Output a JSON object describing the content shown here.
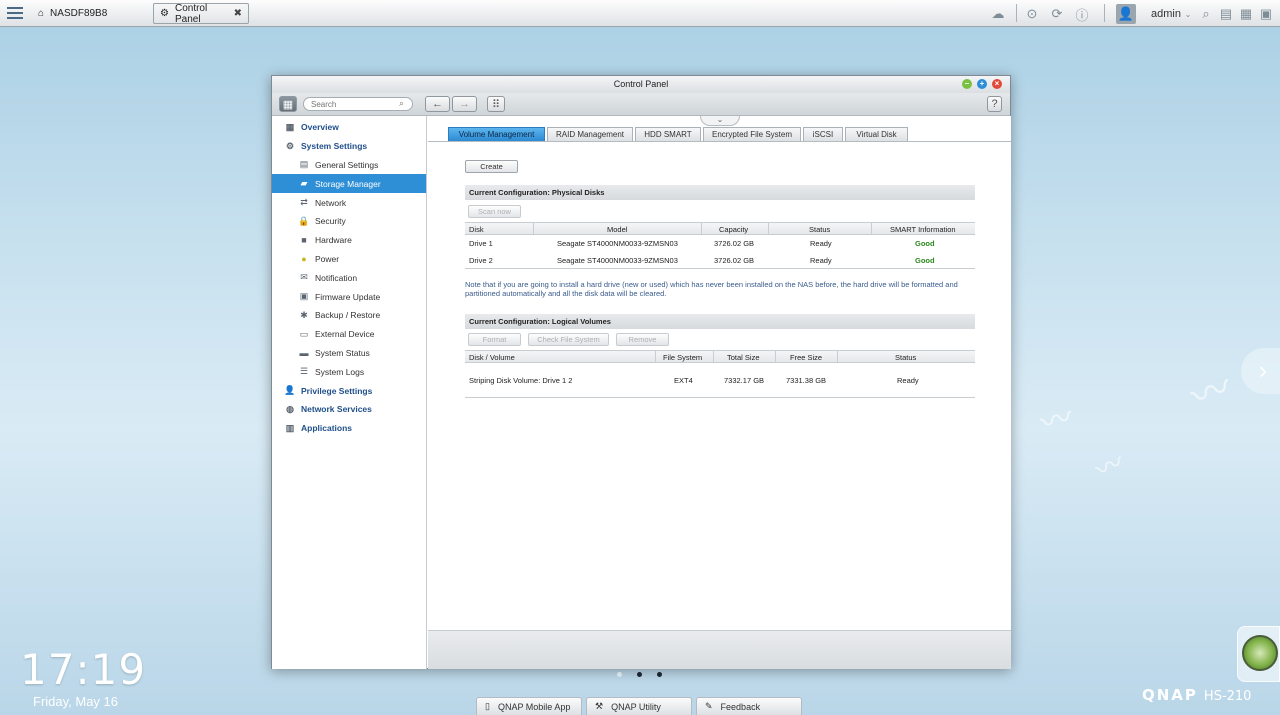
{
  "taskbar": {
    "home_tab": "NASDF89B8",
    "app_tab": "Control Panel",
    "user": "admin"
  },
  "window": {
    "title": "Control Panel",
    "search_placeholder": "Search"
  },
  "sidebar": {
    "items": [
      {
        "label": "Overview",
        "level": "top",
        "icon": "overview-icon"
      },
      {
        "label": "System Settings",
        "level": "top",
        "icon": "gear-icon"
      },
      {
        "label": "General Settings",
        "level": "sub",
        "icon": "general-settings-icon"
      },
      {
        "label": "Storage Manager",
        "level": "sub",
        "icon": "storage-icon",
        "active": true
      },
      {
        "label": "Network",
        "level": "sub",
        "icon": "network-icon"
      },
      {
        "label": "Security",
        "level": "sub",
        "icon": "lock-icon"
      },
      {
        "label": "Hardware",
        "level": "sub",
        "icon": "hardware-icon"
      },
      {
        "label": "Power",
        "level": "sub",
        "icon": "lightbulb-icon"
      },
      {
        "label": "Notification",
        "level": "sub",
        "icon": "notification-icon"
      },
      {
        "label": "Firmware Update",
        "level": "sub",
        "icon": "firmware-icon"
      },
      {
        "label": "Backup / Restore",
        "level": "sub",
        "icon": "backup-icon"
      },
      {
        "label": "External Device",
        "level": "sub",
        "icon": "external-device-icon"
      },
      {
        "label": "System Status",
        "level": "sub",
        "icon": "monitor-icon"
      },
      {
        "label": "System Logs",
        "level": "sub",
        "icon": "logs-icon"
      },
      {
        "label": "Privilege Settings",
        "level": "top",
        "icon": "user-icon"
      },
      {
        "label": "Network Services",
        "level": "top",
        "icon": "globe-icon"
      },
      {
        "label": "Applications",
        "level": "top",
        "icon": "applications-icon"
      }
    ]
  },
  "tabs": [
    "Volume Management",
    "RAID Management",
    "HDD SMART",
    "Encrypted File System",
    "iSCSI",
    "Virtual Disk"
  ],
  "active_tab": "Volume Management",
  "volume": {
    "create_label": "Create",
    "physical_header": "Current Configuration: Physical Disks",
    "scan_label": "Scan now",
    "disk_columns": [
      "Disk",
      "Model",
      "Capacity",
      "Status",
      "SMART Information"
    ],
    "disks": [
      {
        "disk": "Drive 1",
        "model": "Seagate ST4000NM0033-9ZMSN03",
        "capacity": "3726.02 GB",
        "status": "Ready",
        "smart": "Good"
      },
      {
        "disk": "Drive 2",
        "model": "Seagate ST4000NM0033-9ZMSN03",
        "capacity": "3726.02 GB",
        "status": "Ready",
        "smart": "Good"
      }
    ],
    "note": "Note that if you are going to install a hard drive (new or used) which has never been installed on the NAS before, the hard drive will be formatted and partitioned automatically and all the disk data will be cleared.",
    "logical_header": "Current Configuration: Logical Volumes",
    "format_label": "Format",
    "check_label": "Check File System",
    "remove_label": "Remove",
    "volume_columns": [
      "Disk / Volume",
      "File System",
      "Total Size",
      "Free Size",
      "Status"
    ],
    "volumes": [
      {
        "name": "Striping Disk Volume: Drive 1 2",
        "fs": "EXT4",
        "total": "7332.17 GB",
        "free": "7331.38 GB",
        "status": "Ready"
      }
    ]
  },
  "desktop": {
    "time": "17:19",
    "date": "Friday, May 16",
    "brand": "QNAP",
    "model": "HS-210"
  },
  "dock": [
    "QNAP Mobile App",
    "QNAP Utility",
    "Feedback"
  ],
  "colors": {
    "accent": "#2e8fd6",
    "good": "#2a8a1e",
    "note": "#3a5c8c"
  }
}
